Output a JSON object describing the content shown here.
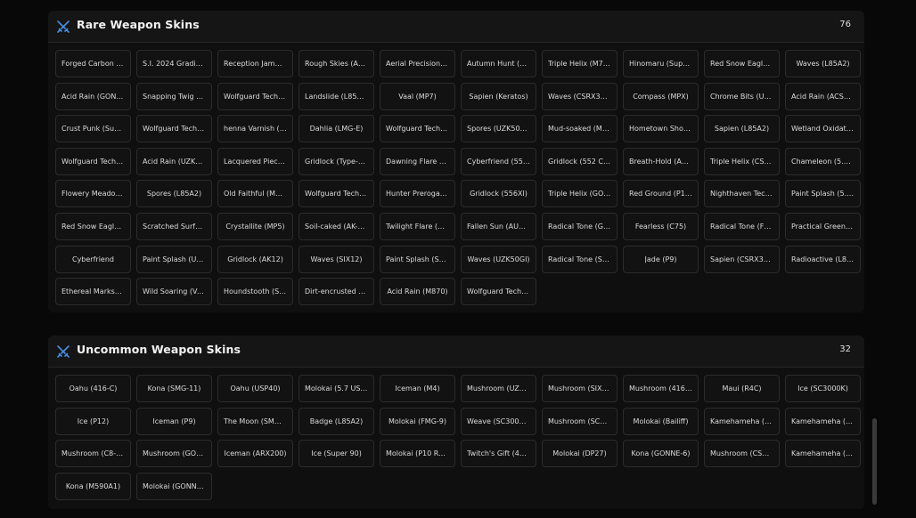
{
  "sections": [
    {
      "title": "Rare Weapon Skins",
      "count": "76",
      "icon": "crossed-swords-icon",
      "items": [
        "Forged Carbon (S...",
        "S.I. 2024 Gradient ...",
        "Reception Jamme...",
        "Rough Skies (AK12)",
        "Aerial Precision (S...",
        "Autumn Hunt (Sc...",
        "Triple Helix (M762)",
        "Hinomaru (Super...",
        "Red Snow Eagle (...",
        "Waves (L85A2)",
        "Acid Rain (GONN...",
        "Snapping Twig (A...",
        "Wolfguard Tech (...",
        "Landslide (L85A2)",
        "Vaal (MP7)",
        "Sapien (Keratos)",
        "Waves (CSRX300)",
        "Compass (MPX)",
        "Chrome Bits (UM...",
        "Acid Rain (ACS12)",
        "Crust Punk (Super...",
        "Wolfguard Tech (S...",
        "henna Varnish (A...",
        "Dahlia (LMG-E)",
        "Wolfguard Tech (S...",
        "Spores (UZK50GI)",
        "Mud-soaked (MP7)",
        "Hometown Shot (...",
        "Sapien (L85A2)",
        "Wetland Oxidatio...",
        "Wolfguard Tech (P...",
        "Acid Rain (UZK50...",
        "Lacquered Piece (...",
        "Gridlock (Type-89)",
        "Dawning Flare (A...",
        "Cyberfriend (556XI)",
        "Gridlock (552 Co...",
        "Breath-Hold (AUG...",
        "Triple Helix (CSRX...",
        "Chameleon (5.7 U...",
        "Flowery Meadow ...",
        "Spores (L85A2)",
        "Old Faithful (MK1...",
        "Wolfguard Tech (T...",
        "Hunter Prerogativ...",
        "Gridlock (556XI)",
        "Triple Helix (GON...",
        "Red Ground (P10 ...",
        "Nighthaven Tech (...",
        "Paint Splash (5.7 ...",
        "Red Snow Eagle (...",
        "Scratched Surface...",
        "Crystallite (MP5)",
        "Soil-caked (AK-74...",
        "Twilight Flare (AU...",
        "Fallen Sun (AUG A...",
        "Radical Tone (GO...",
        "Fearless (C75)",
        "Radical Tone (F90)",
        "Practical Green (U...",
        "Cyberfriend",
        "Paint Splash (UM...",
        "Gridlock (AK12)",
        "Waves (SIX12)",
        "Paint Splash (Sup...",
        "Waves (UZK50GI)",
        "Radical Tone (SDP...",
        "Jade (P9)",
        "Sapien (CSRX300)",
        "Radioactive (L85A2)",
        "Ethereal Marksma...",
        "Wild Soaring (Vec...",
        "Houndstooth (SP...",
        "Dirt-encrusted (9...",
        "Acid Rain (M870)",
        "Wolfguard Tech (F..."
      ]
    },
    {
      "title": "Uncommon Weapon Skins",
      "count": "32",
      "icon": "crossed-swords-icon",
      "items": [
        "Oahu (416-C)",
        "Kona (SMG-11)",
        "Oahu (USP40)",
        "Molokai (5.7 USG)",
        "Iceman (M4)",
        "Mushroom (UZK5...",
        "Mushroom (SIX12...",
        "Mushroom (416-C)",
        "Maui (R4C)",
        "Ice (SC3000K)",
        "Ice (P12)",
        "Iceman (P9)",
        "The Moon (SMG-...",
        "Badge (L85A2)",
        "Molokai (FMG-9)",
        "Weave (SC3000K)",
        "Mushroom (SC30...",
        "Molokai (Bailiff)",
        "Kamehameha (M...",
        "Kamehameha (PA...",
        "Mushroom (C8-SF...",
        "Mushroom (GON...",
        "Iceman (ARX200)",
        "Ice (Super 90)",
        "Molokai (P10 Roni)",
        "Twitch's Gift (417)",
        "Molokai (DP27)",
        "Kona (GONNE-6)",
        "Mushroom (CSRX...",
        "Kamehameha (6P...",
        "Kona (M590A1)",
        "Molokai (GONNE-..."
      ]
    }
  ],
  "colors": {
    "background": "#080808",
    "panel": "#0f0f0f",
    "card": "#121212",
    "card_border": "#2c2c2c",
    "icon_accent": "#4a8fe0"
  }
}
